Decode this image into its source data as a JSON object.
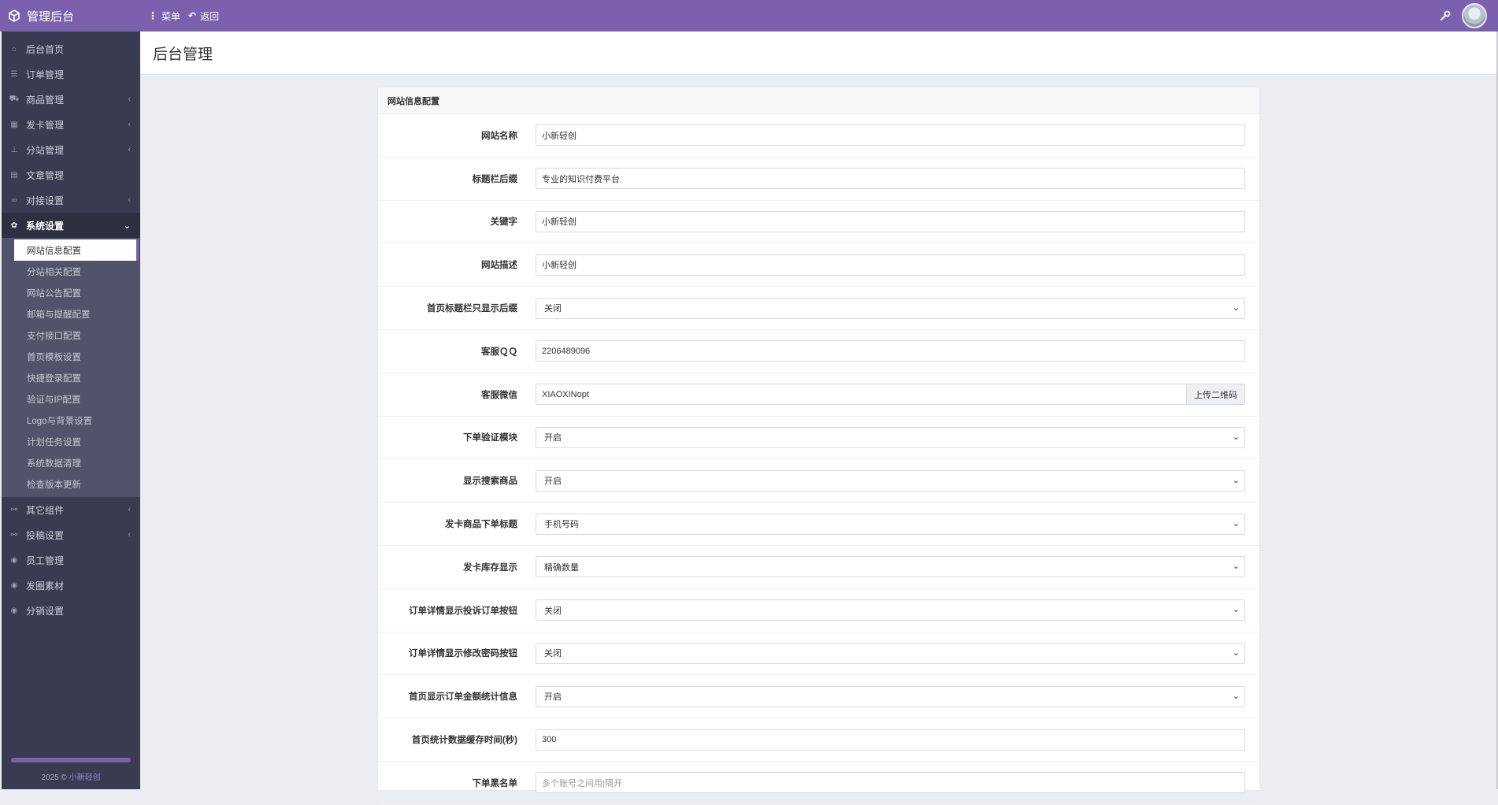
{
  "brand": {
    "title": "管理后台",
    "icon": "cube-icon"
  },
  "topbar": {
    "menu_label": "菜单",
    "back_label": "返回"
  },
  "sidebar": {
    "items": [
      {
        "label": "后台首页",
        "icon": "home-icon",
        "chevron": false
      },
      {
        "label": "订单管理",
        "icon": "list-icon",
        "chevron": false
      },
      {
        "label": "商品管理",
        "icon": "cart-icon",
        "chevron": true
      },
      {
        "label": "发卡管理",
        "icon": "grid-icon",
        "chevron": true
      },
      {
        "label": "分站管理",
        "icon": "sitemap-icon",
        "chevron": true
      },
      {
        "label": "文章管理",
        "icon": "book-icon",
        "chevron": false
      },
      {
        "label": "对接设置",
        "icon": "link-icon",
        "chevron": true
      },
      {
        "label": "系统设置",
        "icon": "gear-icon",
        "chevron": true
      }
    ],
    "system_sub": [
      "网站信息配置",
      "分站相关配置",
      "网站公告配置",
      "邮箱与提醒配置",
      "支付接口配置",
      "首页模板设置",
      "快捷登录配置",
      "验证与IP配置",
      "Logo与背景设置",
      "计划任务设置",
      "系统数据清理",
      "检查版本更新"
    ],
    "items_after": [
      {
        "label": "其它组件",
        "icon": "share-icon",
        "chevron": true
      },
      {
        "label": "投稿设置",
        "icon": "share-icon",
        "chevron": true
      },
      {
        "label": "员工管理",
        "icon": "user-icon",
        "chevron": false
      },
      {
        "label": "发圈素材",
        "icon": "user-icon",
        "chevron": false
      },
      {
        "label": "分销设置",
        "icon": "user-icon",
        "chevron": false
      }
    ],
    "footer_year": "2025 ©",
    "footer_link": "小新轻创"
  },
  "page": {
    "title": "后台管理"
  },
  "panel": {
    "title": "网站信息配置",
    "fields": [
      {
        "label": "网站名称",
        "type": "input",
        "value": "小新轻创"
      },
      {
        "label": "标题栏后缀",
        "type": "input",
        "value": "专业的知识付费平台"
      },
      {
        "label": "关键字",
        "type": "input",
        "value": "小新轻创"
      },
      {
        "label": "网站描述",
        "type": "input",
        "value": "小新轻创"
      },
      {
        "label": "首页标题栏只显示后缀",
        "type": "select",
        "value": "关闭"
      },
      {
        "label": "客服ＱＱ",
        "type": "input",
        "value": "2206489096"
      },
      {
        "label": "客服微信",
        "type": "group",
        "value": "XIAOXINopt",
        "addon": "上传二维码"
      },
      {
        "label": "下单验证模块",
        "type": "select",
        "value": "开启"
      },
      {
        "label": "显示搜索商品",
        "type": "select",
        "value": "开启"
      },
      {
        "label": "发卡商品下单标题",
        "type": "select",
        "value": "手机号码"
      },
      {
        "label": "发卡库存显示",
        "type": "select",
        "value": "精确数量"
      },
      {
        "label": "订单详情显示投诉订单按钮",
        "type": "select",
        "value": "关闭"
      },
      {
        "label": "订单详情显示修改密码按钮",
        "type": "select",
        "value": "关闭"
      },
      {
        "label": "首页显示订单金额统计信息",
        "type": "select",
        "value": "开启"
      },
      {
        "label": "首页统计数据缓存时间(秒)",
        "type": "input",
        "value": "300"
      },
      {
        "label": "下单黑名单",
        "type": "placeholder",
        "placeholder": "多个账号之间用|隔开"
      }
    ]
  },
  "colors": {
    "accent": "#7b61ad",
    "sidebar_bg": "#393c50"
  }
}
